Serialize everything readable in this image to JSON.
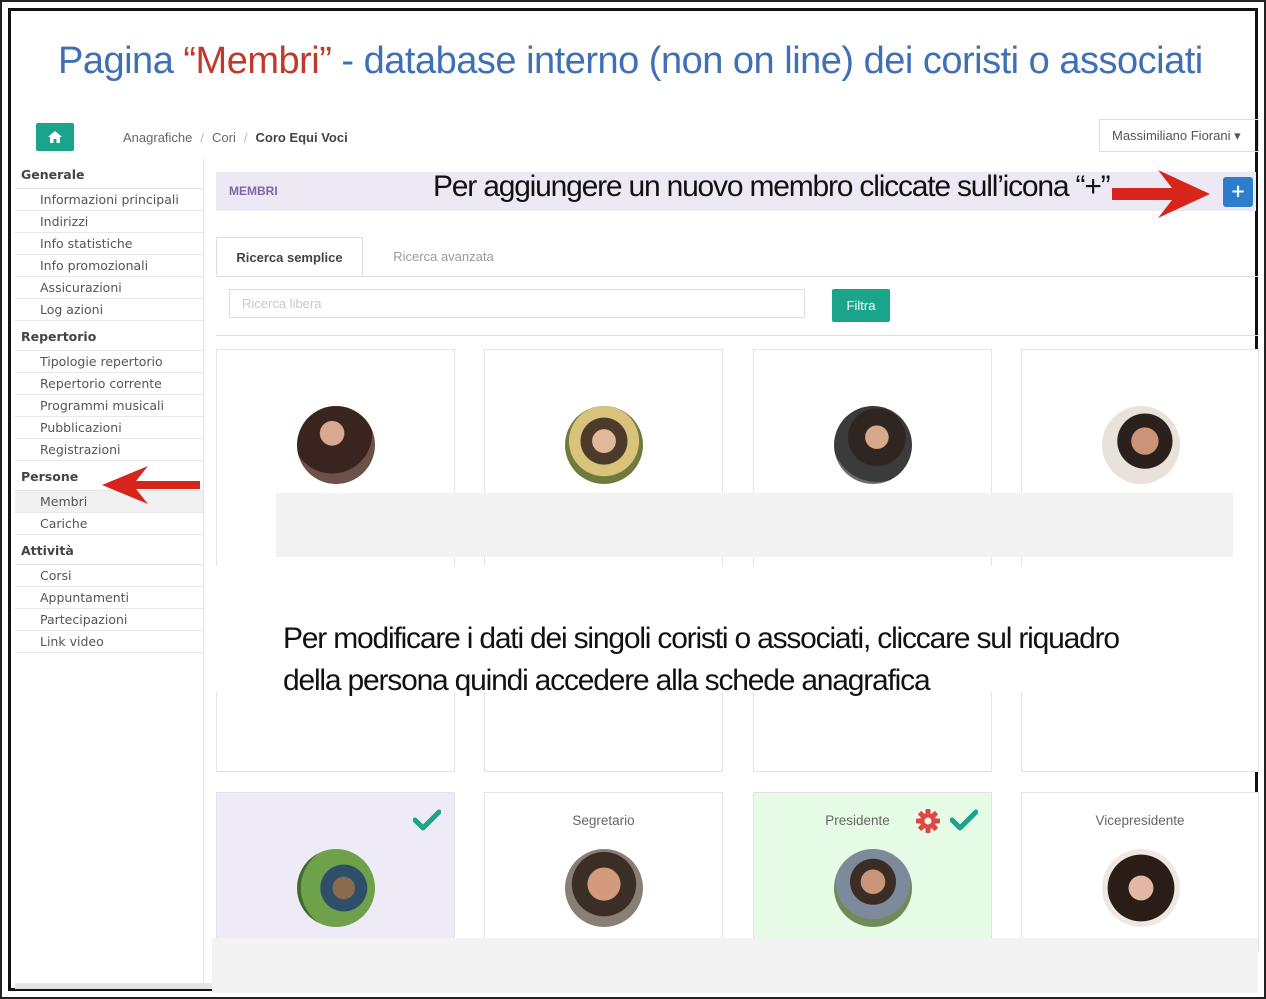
{
  "slide": {
    "title_pre": "Pagina ",
    "title_highlight": "“Membri”",
    "title_post": " - database interno (non on line) dei coristi o associati",
    "annotation_add": "Per aggiungere un nuovo membro cliccate sull’icona “+”",
    "annotation_edit_line1": "Per modificare i dati dei singoli coristi o associati, cliccare sul riquadro",
    "annotation_edit_line2": "della persona quindi accedere alla schede anagrafica"
  },
  "topbar": {
    "home_icon": "home-icon",
    "breadcrumb": [
      "Anagrafiche",
      "Cori",
      "Coro Equi Voci"
    ],
    "breadcrumb_separator": "/",
    "user_name": "Massimiliano Fiorani ▾"
  },
  "sidebar": {
    "groups": [
      {
        "title": "Generale",
        "items": [
          "Informazioni principali",
          "Indirizzi",
          "Info statistiche",
          "Info promozionali",
          "Assicurazioni",
          "Log azioni"
        ]
      },
      {
        "title": "Repertorio",
        "items": [
          "Tipologie repertorio",
          "Repertorio corrente",
          "Programmi musicali",
          "Pubblicazioni",
          "Registrazioni"
        ]
      },
      {
        "title": "Persone",
        "items": [
          "Membri",
          "Cariche"
        ]
      },
      {
        "title": "Attività",
        "items": [
          "Corsi",
          "Appuntamenti",
          "Partecipazioni",
          "Link video"
        ]
      }
    ],
    "active_item": "Membri"
  },
  "main": {
    "section_label": "MEMBRI",
    "add_button": "+",
    "tabs": [
      "Ricerca semplice",
      "Ricerca avanzata"
    ],
    "search_placeholder": "Ricerca libera",
    "filter_button": "Filtra"
  },
  "cards_row2": [
    {
      "role": "",
      "checked": true,
      "settings": false
    },
    {
      "role": "Segretario",
      "checked": false,
      "settings": false
    },
    {
      "role": "Presidente",
      "checked": true,
      "settings": true
    },
    {
      "role": "Vicepresidente",
      "checked": false,
      "settings": false
    }
  ],
  "colors": {
    "title_blue": "#3f6fb5",
    "title_red": "#c0392b",
    "accent_green": "#1aa58a",
    "add_blue": "#2c7dcc",
    "arrow_red": "#d8251c",
    "gear_red": "#e04646",
    "check_green": "#1aa58a"
  }
}
